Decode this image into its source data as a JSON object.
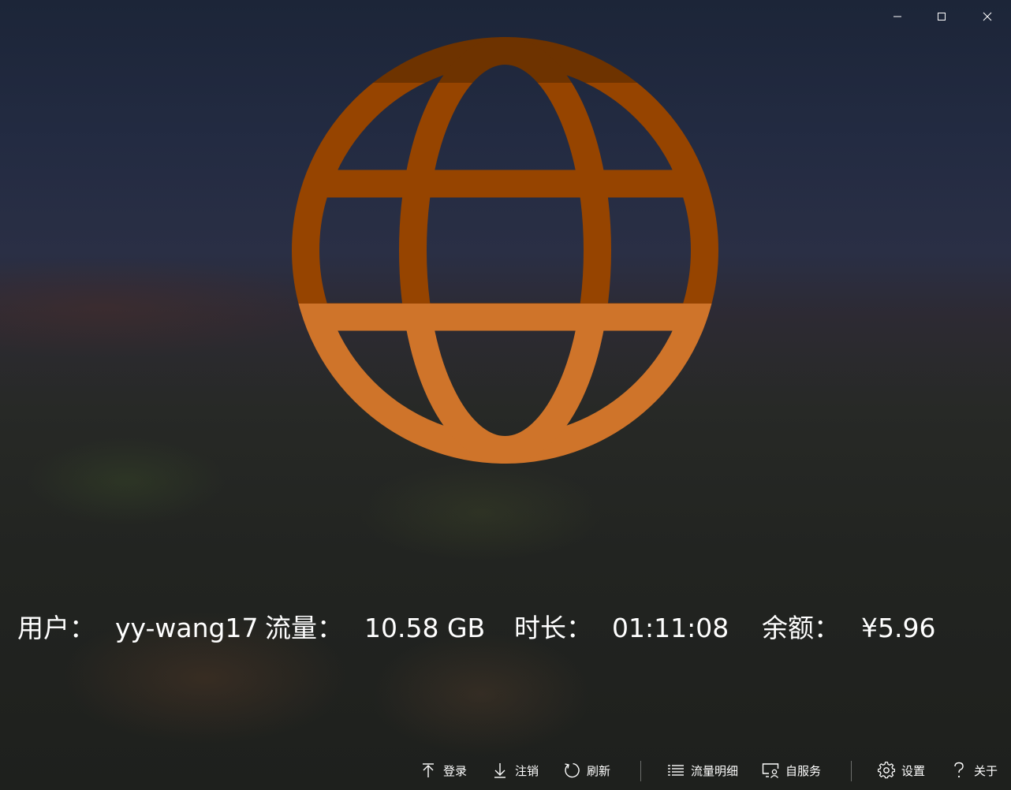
{
  "window": {
    "caption_buttons": [
      "minimize-icon",
      "maximize-icon",
      "close-icon"
    ]
  },
  "status": {
    "icon": "globe-icon",
    "colors": {
      "top": "#6e3300",
      "middle": "#964400",
      "bottom": "#cf742a"
    }
  },
  "stats": {
    "user_label": "用户：",
    "user_value": "yy-wang17",
    "traffic_label": "流量：",
    "traffic_value": "10.58 GB",
    "duration_label": "时长：",
    "duration_value": "01:11:08",
    "balance_label": "余额：",
    "balance_value": "¥5.96"
  },
  "toolbar": {
    "login": {
      "label": "登录",
      "icon": "arrow-up-to-line-icon"
    },
    "logout": {
      "label": "注销",
      "icon": "arrow-down-icon"
    },
    "refresh": {
      "label": "刷新",
      "icon": "refresh-icon"
    },
    "traffic_detail": {
      "label": "流量明细",
      "icon": "list-icon"
    },
    "self_service": {
      "label": "自服务",
      "icon": "monitor-user-icon"
    },
    "settings": {
      "label": "设置",
      "icon": "gear-icon"
    },
    "about": {
      "label": "关于",
      "icon": "question-icon"
    }
  }
}
